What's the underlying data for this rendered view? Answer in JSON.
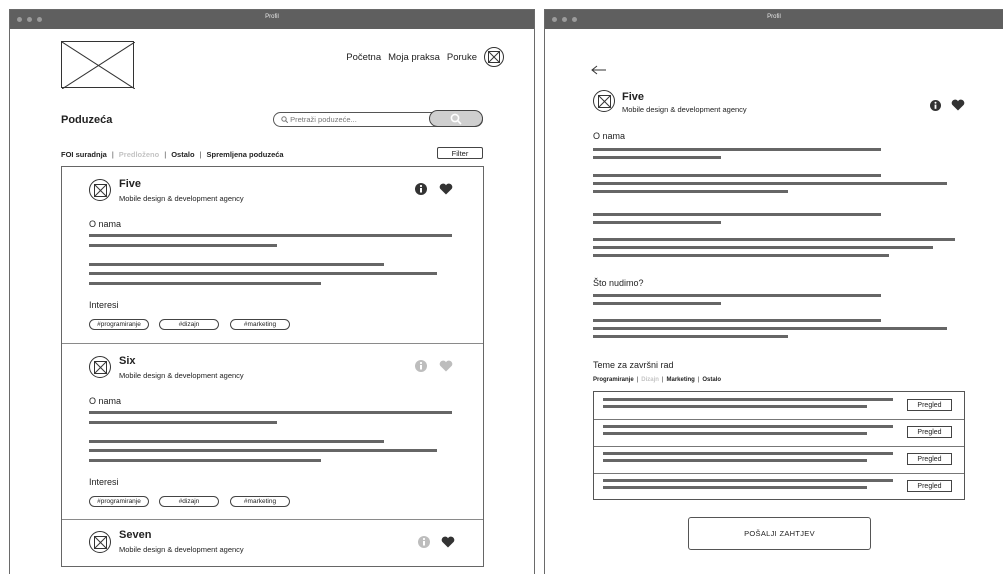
{
  "left_window": {
    "title": "Profil",
    "nav": {
      "home": "Početna",
      "practice": "Moja praksa",
      "messages": "Poruke"
    },
    "page_title": "Poduzeća",
    "search": {
      "placeholder": "Pretraži poduzeće..."
    },
    "tabs": [
      {
        "label": "FOI suradnja",
        "active": true
      },
      {
        "label": "Predloženo",
        "active": false
      },
      {
        "label": "Ostalo",
        "active": true
      },
      {
        "label": "Spremljena poduzeća",
        "active": true
      }
    ],
    "tab_separator": "|",
    "filter_label": "Filter",
    "companies": [
      {
        "name": "Five",
        "subtitle": "Mobile design & development agency",
        "about_label": "O nama",
        "interests_label": "Interesi",
        "tags": [
          "#programiranje",
          "#dizajn",
          "#marketing"
        ],
        "icon_state": "dark"
      },
      {
        "name": "Six",
        "subtitle": "Mobile design & development agency",
        "about_label": "O nama",
        "interests_label": "Interesi",
        "tags": [
          "#programiranje",
          "#dizajn",
          "#marketing"
        ],
        "icon_state": "light"
      },
      {
        "name": "Seven",
        "subtitle": "Mobile design & development agency",
        "icon_state": "light-info-dark-heart"
      }
    ]
  },
  "right_window": {
    "title": "Profil",
    "company": {
      "name": "Five",
      "subtitle": "Mobile design & development agency"
    },
    "about_label": "O nama",
    "offer_label": "Što nudimo?",
    "thesis_label": "Teme za završni rad",
    "thesis_tabs": [
      {
        "label": "Programiranje",
        "active": true
      },
      {
        "label": "Dizajn",
        "active": false
      },
      {
        "label": "Marketing",
        "active": true
      },
      {
        "label": "Ostalo",
        "active": true
      }
    ],
    "topics": [
      {
        "button": "Pregled"
      },
      {
        "button": "Pregled"
      },
      {
        "button": "Pregled"
      },
      {
        "button": "Pregled"
      }
    ],
    "send_label": "POŠALJI ZAHTJEV"
  },
  "colors": {
    "titlebar": "#5f5f5f",
    "placeholder_line": "#666666",
    "muted_text": "#c4c4c4"
  },
  "icons": [
    "image-placeholder-icon",
    "avatar-placeholder-icon",
    "search-icon",
    "info-icon",
    "heart-icon",
    "back-arrow-icon"
  ]
}
